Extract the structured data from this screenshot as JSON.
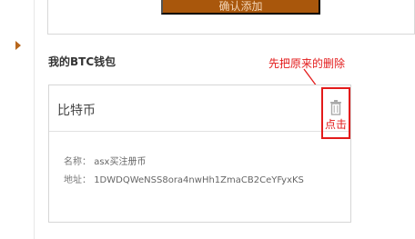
{
  "top_action": {
    "confirm_label": "确认添加"
  },
  "wallet_section": {
    "title": "我的BTC钱包"
  },
  "annotation": {
    "instruction": "先把原来的删除",
    "click_label": "点击"
  },
  "wallet": {
    "currency": "比特币",
    "name_label": "名称：",
    "name_value": "asx买注册币",
    "address_label": "地址：",
    "address_value": "1DWDQWeNSS8ora4nwHh1ZmaCB2CeYFyxKS"
  },
  "icons": {
    "delete": "trash-icon",
    "nav_indicator": "triangle-right-icon",
    "callout": "arrow-icon"
  },
  "colors": {
    "button": "#a9570c",
    "annotation": "#e31b1b",
    "text": "#444444",
    "border": "#d6d6d6"
  }
}
